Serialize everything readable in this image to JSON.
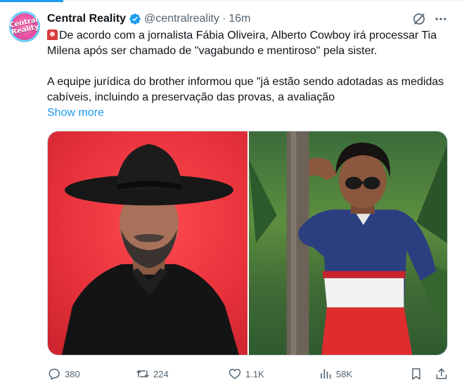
{
  "tweet": {
    "author": {
      "display_name": "Central Reality",
      "handle": "@centralreality",
      "verified": true,
      "avatar_logo_text": "Central Reality"
    },
    "separator": "·",
    "time": "16m",
    "paragraph1": "De acordo com a jornalista Fábia Oliveira, Alberto Cowboy irá processar Tia Milena após ser chamado de \"vagabundo e mentiroso\" pela sister.",
    "paragraph2": "A equipe jurídica do brother informou que \"já estão sendo adotadas as medidas cabíveis, incluindo a preservação das provas, a avaliação",
    "show_more": "Show more",
    "emoji_icon": "rotating-light-icon"
  },
  "actions": {
    "replies": "380",
    "reposts": "224",
    "likes": "1.1K",
    "views": "58K"
  },
  "colors": {
    "accent": "#1d9bf0",
    "text": "#0f1419",
    "secondary_text": "#536471"
  }
}
